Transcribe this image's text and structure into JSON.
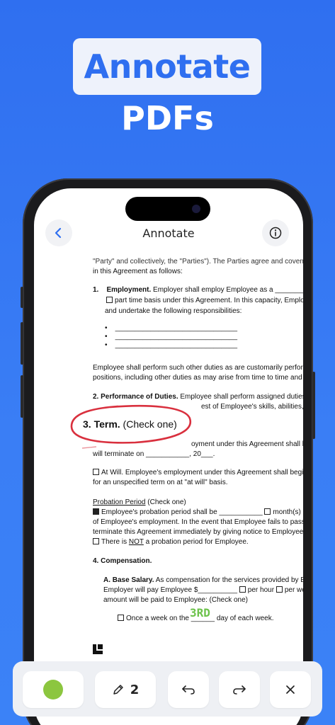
{
  "hero": {
    "title": "Annotate",
    "subtitle": "PDFs"
  },
  "nav": {
    "title": "Annotate"
  },
  "doc": {
    "l1": "\"Party\" and collectively, the \"Parties\"). The Parties agree and covenant",
    "l2": "in this Agreement as follows:",
    "employment_num": "1.",
    "employment_head": "Employment.",
    "employment_text": " Employer shall employ Employee as a ____________",
    "employment_l2": "part time basis under this Agreement. In this capacity, Employee",
    "employment_l3": "and undertake the following responsibilities:",
    "bullet_line": "_______________________________",
    "duties_l1": "Employee shall perform such other duties as are customarily performed",
    "duties_l2": "positions, including other duties as may arise from time to time and as",
    "performance_head": "2. Performance of Duties.",
    "performance_text": " Employee shall perform assigned duties and",
    "performance_l2": "est of Employee's skills, abilities, talents",
    "term_head": "3. Term.",
    "term_check": " (Check one)",
    "term_l1": "oyment under this Agreement shall begin",
    "term_l2": "will terminate on ___________, 20___.",
    "at_will_l1": "At Will.  Employee's employment under this Agreement shall begin",
    "at_will_l2": "for an unspecified term on at \"at will\" basis.",
    "probation_head": "Probation Period",
    "probation_check": " (Check one)",
    "probation_l1": "Employee's probation period shall be ___________",
    "probation_l1b": "month(s)",
    "probation_l2": "of Employee's employment. In the event that Employee fails to pass the",
    "probation_l3": "terminate this Agreement immediately by giving notice to Employee.",
    "no_probation_a": "There is ",
    "no_probation_not": "NOT",
    "no_probation_b": " a probation period for Employee.",
    "compensation_head": "4. Compensation.",
    "salary_head": "A. Base Salary.",
    "salary_text": " As compensation for the services provided by Emp",
    "salary_l2a": "Employer will pay Employee $__________",
    "salary_l2b": "per hour",
    "salary_l2c": "per week",
    "salary_l3": "amount will be paid to Employee: (Check one)",
    "once_a": "Once a week on the ______ day of each week.",
    "handwritten": "3RD"
  },
  "toolbar": {
    "stroke_size": "2"
  },
  "colors": {
    "accent": "#2f6ff0",
    "pen_green": "#8cc63f",
    "ink_red": "#d9303e",
    "ink_green": "#6cc24a"
  }
}
